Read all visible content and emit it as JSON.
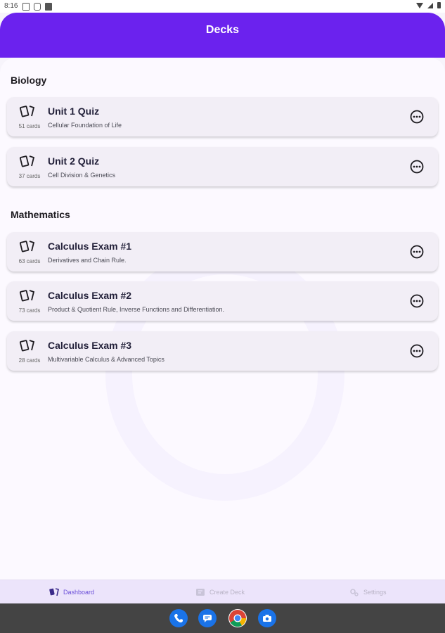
{
  "status_bar": {
    "time": "8:16"
  },
  "app_bar": {
    "title": "Decks"
  },
  "sections": [
    {
      "title": "Biology",
      "decks": [
        {
          "name": "Unit 1 Quiz",
          "description": "Cellular Foundation of Life",
          "count": "51 cards"
        },
        {
          "name": "Unit 2 Quiz",
          "description": "Cell Division & Genetics",
          "count": "37 cards"
        }
      ]
    },
    {
      "title": "Mathematics",
      "decks": [
        {
          "name": "Calculus Exam #1",
          "description": "Derivatives and Chain Rule.",
          "count": "63 cards"
        },
        {
          "name": "Calculus Exam #2",
          "description": "Product & Quotient Rule, Inverse Functions and Differentiation.",
          "count": "73 cards"
        },
        {
          "name": "Calculus Exam #3",
          "description": "Multivariable Calculus & Advanced Topics",
          "count": "28 cards"
        }
      ]
    }
  ],
  "bottom_nav": [
    {
      "label": "Dashboard",
      "icon": "cards-icon",
      "active": true
    },
    {
      "label": "Create Deck",
      "icon": "create-deck-icon",
      "active": false
    },
    {
      "label": "Settings",
      "icon": "gears-icon",
      "active": false
    }
  ],
  "dock_apps": [
    {
      "icon": "phone-icon",
      "color": "#1a73e8"
    },
    {
      "icon": "messages-icon",
      "color": "#1a73e8"
    },
    {
      "icon": "chrome-icon",
      "color": "#ffffff"
    },
    {
      "icon": "camera-icon",
      "color": "#1a73e8"
    }
  ],
  "colors": {
    "accent": "#6b22ee",
    "background": "#fcf9ff",
    "card": "#f2eef6"
  }
}
